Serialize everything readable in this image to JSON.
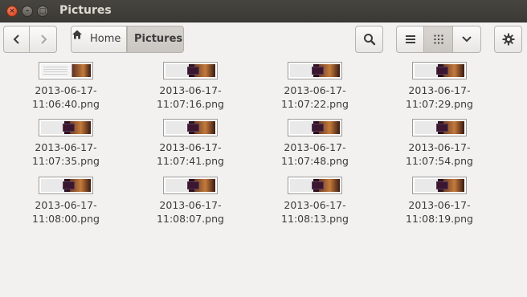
{
  "window": {
    "title": "Pictures",
    "close_glyph": "×",
    "min_glyph": "–",
    "max_glyph": "□"
  },
  "toolbar": {
    "back_icon": "chevron-left-icon",
    "forward_icon": "chevron-right-icon",
    "breadcrumb": {
      "home_label": "Home",
      "current_label": "Pictures"
    },
    "search_icon": "search-icon",
    "view_list_icon": "list-view-icon",
    "view_grid_icon": "grid-view-icon",
    "view_menu_icon": "chevron-down-icon",
    "settings_icon": "gear-icon"
  },
  "files": [
    {
      "line1": "2013-06-17-",
      "line2": "11:06:40.png"
    },
    {
      "line1": "2013-06-17-",
      "line2": "11:07:16.png"
    },
    {
      "line1": "2013-06-17-",
      "line2": "11:07:22.png"
    },
    {
      "line1": "2013-06-17-",
      "line2": "11:07:29.png"
    },
    {
      "line1": "2013-06-17-",
      "line2": "11:07:35.png"
    },
    {
      "line1": "2013-06-17-",
      "line2": "11:07:41.png"
    },
    {
      "line1": "2013-06-17-",
      "line2": "11:07:48.png"
    },
    {
      "line1": "2013-06-17-",
      "line2": "11:07:54.png"
    },
    {
      "line1": "2013-06-17-",
      "line2": "11:08:00.png"
    },
    {
      "line1": "2013-06-17-",
      "line2": "11:08:07.png"
    },
    {
      "line1": "2013-06-17-",
      "line2": "11:08:13.png"
    },
    {
      "line1": "2013-06-17-",
      "line2": "11:08:19.png"
    }
  ]
}
